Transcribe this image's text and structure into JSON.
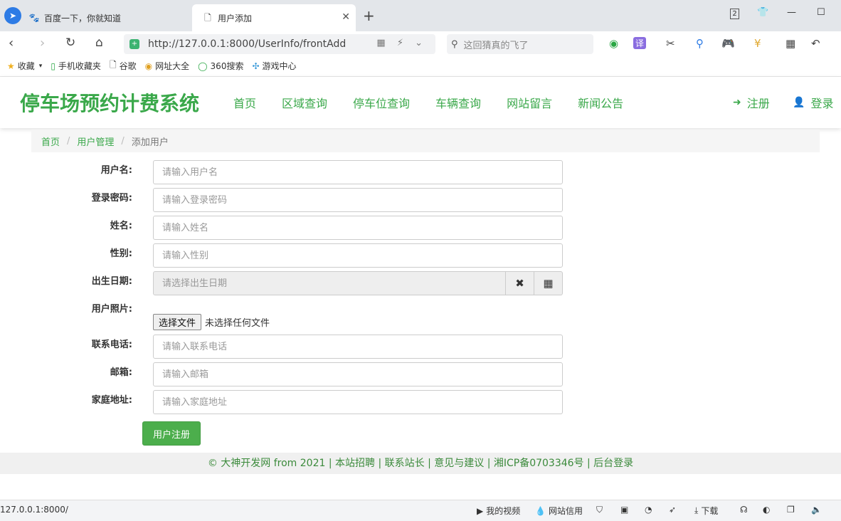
{
  "browser": {
    "tabs": [
      {
        "title": "百度一下，你就知道",
        "icon": "paw-icon"
      },
      {
        "title": "用户添加",
        "icon": "page-icon"
      }
    ],
    "tab_count": "2",
    "url": "http://127.0.0.1:8000/UserInfo/frontAdd",
    "search_placeholder": "这回猜真的飞了",
    "bookmarks": [
      {
        "label": "收藏",
        "icon": "star-icon"
      },
      {
        "label": "手机收藏夹",
        "icon": "phone-icon"
      },
      {
        "label": "谷歌",
        "icon": "page-icon"
      },
      {
        "label": "网址大全",
        "icon": "globe-icon"
      },
      {
        "label": "360搜索",
        "icon": "search-360-icon"
      },
      {
        "label": "游戏中心",
        "icon": "game-icon"
      }
    ],
    "toolbar_translate": "译"
  },
  "site": {
    "brand": "停车场预约计费系统",
    "nav": [
      "首页",
      "区域查询",
      "停车位查询",
      "车辆查询",
      "网站留言",
      "新闻公告"
    ],
    "register": "注册",
    "login": "登录"
  },
  "breadcrumb": {
    "home": "首页",
    "section": "用户管理",
    "current": "添加用户"
  },
  "form": {
    "username": {
      "label": "用户名:",
      "placeholder": "请输入用户名"
    },
    "password": {
      "label": "登录密码:",
      "placeholder": "请输入登录密码"
    },
    "name": {
      "label": "姓名:",
      "placeholder": "请输入姓名"
    },
    "gender": {
      "label": "性别:",
      "placeholder": "请输入性别"
    },
    "birthday": {
      "label": "出生日期:",
      "placeholder": "请选择出生日期"
    },
    "photo": {
      "label": "用户照片:",
      "button": "选择文件",
      "status": "未选择任何文件"
    },
    "phone": {
      "label": "联系电话:",
      "placeholder": "请输入联系电话"
    },
    "email": {
      "label": "邮箱:",
      "placeholder": "请输入邮箱"
    },
    "address": {
      "label": "家庭地址:",
      "placeholder": "请输入家庭地址"
    },
    "submit": "用户注册"
  },
  "footer": {
    "text": "© 大神开发网 from 2021 | 本站招聘 | 联系站长 | 意见与建议 | 湘ICP备0703346号 | 后台登录"
  },
  "statusbar": {
    "url": "127.0.0.1:8000/",
    "my_video": "我的视频",
    "site_credit": "网站信用",
    "download": "下载"
  },
  "colors": {
    "accent": "#3aa84a",
    "button": "#4cae4c",
    "footer_text": "#3b8a3b"
  }
}
